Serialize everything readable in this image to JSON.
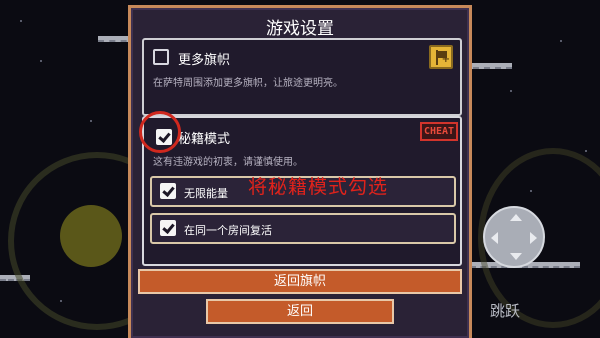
{
  "dialog": {
    "title": "游戏设置"
  },
  "options": {
    "more_flags": {
      "label": "更多旗帜",
      "description": "在萨特周围添加更多旗帜，让旅途更明亮。",
      "checked": false,
      "icon": "flag-plus-icon"
    },
    "cheat_mode": {
      "label": "秘籍模式",
      "description": "这有违游戏的初衷，请谨慎使用。",
      "checked": true,
      "badge": "CHEAT",
      "sub_options": [
        {
          "label": "无限能量",
          "checked": true
        },
        {
          "label": "在同一个房间复活",
          "checked": true
        }
      ]
    }
  },
  "annotation": {
    "text": "将秘籍模式勾选",
    "color": "#e0231b"
  },
  "buttons": {
    "return_flag": "返回旗帜",
    "back": "返回"
  },
  "hud": {
    "jump_label": "跳跃"
  },
  "colors": {
    "accent_orange": "#c45b2a",
    "dialog_border": "#c7895a",
    "cheat_red": "#d2342c",
    "background": "#0b0b12"
  }
}
